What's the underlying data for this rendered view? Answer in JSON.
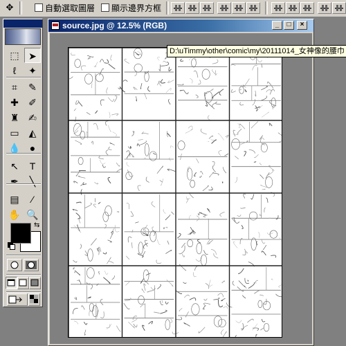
{
  "options_bar": {
    "tool_icon": "move-tool-icon",
    "auto_select_layer": {
      "label": "自動選取圖層",
      "checked": false
    },
    "show_bounding_box": {
      "label": "顯示邊界方框",
      "checked": false
    }
  },
  "toolbox": {
    "tools": [
      {
        "name": "rect-marquee-tool-icon",
        "glyph": "⬚"
      },
      {
        "name": "move-tool-icon",
        "glyph": "➤",
        "active": true
      },
      {
        "name": "lasso-tool-icon",
        "glyph": "ℓ"
      },
      {
        "name": "magic-wand-tool-icon",
        "glyph": "✦"
      },
      {
        "name": "crop-tool-icon",
        "glyph": "⌗"
      },
      {
        "name": "slice-tool-icon",
        "glyph": "✎"
      },
      {
        "name": "healing-brush-tool-icon",
        "glyph": "✚"
      },
      {
        "name": "brush-tool-icon",
        "glyph": "✐"
      },
      {
        "name": "clone-stamp-tool-icon",
        "glyph": "♜"
      },
      {
        "name": "history-brush-tool-icon",
        "glyph": "✍"
      },
      {
        "name": "eraser-tool-icon",
        "glyph": "▭"
      },
      {
        "name": "paint-bucket-tool-icon",
        "glyph": "◭"
      },
      {
        "name": "blur-tool-icon",
        "glyph": "💧"
      },
      {
        "name": "dodge-tool-icon",
        "glyph": "●"
      },
      {
        "name": "path-selection-tool-icon",
        "glyph": "↖"
      },
      {
        "name": "type-tool-icon",
        "glyph": "T"
      },
      {
        "name": "pen-tool-icon",
        "glyph": "✒"
      },
      {
        "name": "line-tool-icon",
        "glyph": "╲"
      },
      {
        "name": "notes-tool-icon",
        "glyph": "▤"
      },
      {
        "name": "eyedropper-tool-icon",
        "glyph": "⁄"
      },
      {
        "name": "hand-tool-icon",
        "glyph": "✋"
      },
      {
        "name": "zoom-tool-icon",
        "glyph": "🔍"
      }
    ],
    "foreground_color": "#000000",
    "background_color": "#ffffff"
  },
  "document": {
    "title": "source.jpg @ 12.5% (RGB)",
    "path_tooltip": "D:\\uTimmy\\other\\comic\\my\\20111014_女神像的腰巾",
    "minimize": "_",
    "maximize": "□",
    "close": "×"
  },
  "colors": {
    "title_active": "#0a246a",
    "face": "#d4d0c8",
    "workspace": "#808080"
  }
}
